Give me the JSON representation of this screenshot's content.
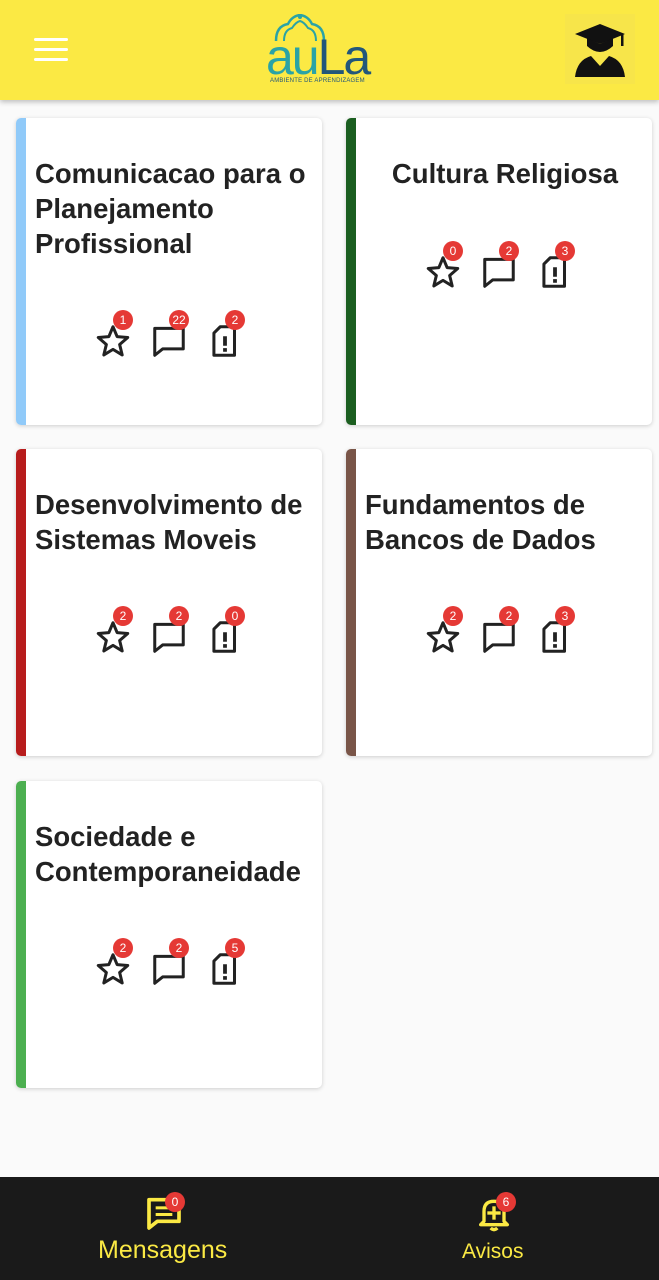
{
  "header": {
    "logo_text_a": "au",
    "logo_text_b": "La",
    "logo_subtitle": "AMBIENTE DE APRENDIZAGEM",
    "brand_color": "#fbe944"
  },
  "courses": [
    {
      "title": "Comunicacao para o Planejamento Profissional",
      "stripe_color": "#90caf9",
      "favorites": "1",
      "messages": "22",
      "alerts": "2"
    },
    {
      "title": "Cultura Religiosa",
      "stripe_color": "#1b5e20",
      "favorites": "0",
      "messages": "2",
      "alerts": "3"
    },
    {
      "title": "Desenvolvimento de Sistemas Moveis",
      "stripe_color": "#b71c1c",
      "favorites": "2",
      "messages": "2",
      "alerts": "0"
    },
    {
      "title": "Fundamentos de Bancos de Dados",
      "stripe_color": "#795548",
      "favorites": "2",
      "messages": "2",
      "alerts": "3"
    },
    {
      "title": "Sociedade e Contemporaneidade",
      "stripe_color": "#4caf50",
      "favorites": "2",
      "messages": "2",
      "alerts": "5"
    }
  ],
  "bottom_nav": {
    "messages": {
      "label": "Mensagens",
      "count": "0",
      "icon": "message-icon"
    },
    "notices": {
      "label": "Avisos",
      "count": "6",
      "icon": "bell-plus-icon"
    }
  },
  "icons": {
    "favorite": "star-icon",
    "messages": "chat-icon",
    "alerts": "document-alert-icon"
  }
}
